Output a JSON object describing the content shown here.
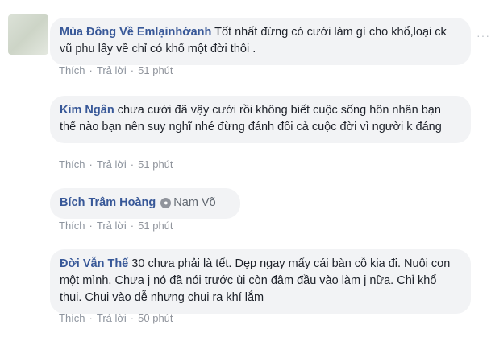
{
  "comments": [
    {
      "author": "Mùa Đông Về Emlạinhớanh",
      "text": "Tốt nhất đừng có cưới làm gì cho khổ,loại ck vũ phu lấy về chỉ có khổ một đời thôi .",
      "like_label": "Thích",
      "reply_label": "Trả lời",
      "time": "51 phút"
    },
    {
      "author": "Kim Ngân",
      "text": "chưa cưới đã vậy cưới rồi không biết cuộc sống hôn nhân bạn thế nào bạn nên suy nghĩ nhé đừng đánh đổi cả cuộc đời vì người k đáng",
      "like_label": "Thích",
      "reply_label": "Trả lời",
      "time": "51 phút"
    },
    {
      "author": "Bích Trâm Hoàng",
      "mention": "Nam Võ",
      "like_label": "Thích",
      "reply_label": "Trả lời",
      "time": "51 phút"
    },
    {
      "author": "Đời Vẫn Thế",
      "text": "30 chưa phải là tết. Dẹp ngay mấy cái bàn cỗ kia đi. Nuôi con một mình. Chưa j nó đã nói trước ùi còn đâm đầu vào làm j nữa. Chỉ khổ thui. Chui vào dễ nhưng chui ra khí lắm",
      "like_label": "Thích",
      "reply_label": "Trả lời",
      "time": "50 phút"
    }
  ],
  "icons": {
    "more": "more-options-icon",
    "mention": "user-mention-icon"
  },
  "colors": {
    "author": "#385898",
    "bubble": "#f2f3f5",
    "meta": "#90949c"
  }
}
